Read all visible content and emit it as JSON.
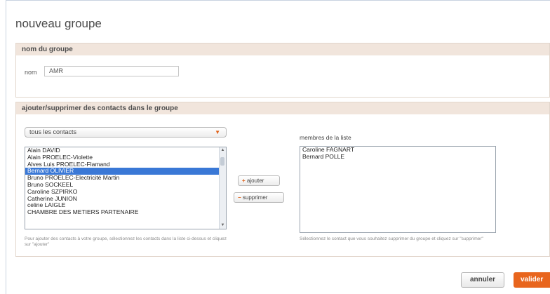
{
  "dialog": {
    "title": "nouveau groupe"
  },
  "group_name_section": {
    "heading": "nom du groupe",
    "name_label": "nom",
    "name_value": "AMR"
  },
  "contacts_section": {
    "heading": "ajouter/supprimer des contacts dans le groupe",
    "filter_select": {
      "selected": "tous les contacts"
    },
    "contacts": [
      "Alain DAVID",
      "Alain PROELEC-Violette",
      "Alves Luis PROELEC-Flamand",
      "Bernard OLIVIER",
      "Bruno PROELEC-Electricité Martin",
      "Bruno SOCKEEL",
      "Caroline SZPIRKO",
      "Catherine JUNION",
      "celine LAIGLE",
      "CHAMBRE DES METIERS PARTENAIRE"
    ],
    "selected_contact_index": 3,
    "add_button": "ajouter",
    "remove_button": "supprimer",
    "members_label": "membres de la liste",
    "members": [
      "Caroline FAGNART",
      "Bernard POLLE"
    ],
    "help_left": "Pour ajouter des contacts à votre groupe, sélectionnez les contacts dans la liste ci-dessus et cliquez sur \"ajouter\"",
    "help_right": "Sélectionnez le contact que vous souhaitez supprimer du groupe et cliquez sur \"supprimer\""
  },
  "footer": {
    "cancel_button": "annuler",
    "validate_button": "valider"
  },
  "colors": {
    "accent": "#e8651d",
    "section_header_bg": "#f1e5dc",
    "selection": "#3a78d6"
  }
}
